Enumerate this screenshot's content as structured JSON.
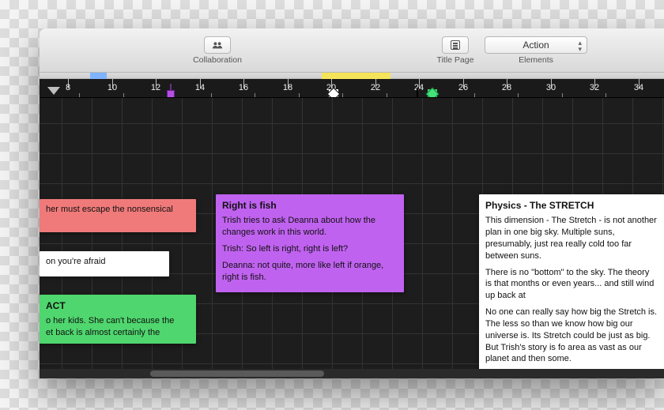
{
  "toolbar": {
    "collaboration_label": "Collaboration",
    "titlepage_label": "Title Page",
    "elements_label": "Elements",
    "elements_selected": "Action"
  },
  "ruler": {
    "ticks": [
      8,
      10,
      12,
      14,
      16,
      18,
      20,
      22,
      24,
      26,
      28,
      30,
      32,
      34
    ],
    "highlights": {
      "blue": {
        "start": 9,
        "end": 9.8
      },
      "yellow": {
        "start": 19.6,
        "end": 22.8
      }
    },
    "markers": {
      "scrubber": 7.3,
      "purple": 12.6,
      "diamond_white": 20.1,
      "square_white": 24.1,
      "diamond_green": 24.6
    }
  },
  "cards": {
    "pink": {
      "text": "her must escape the nonsensical"
    },
    "white_small": {
      "text": "on you're afraid"
    },
    "green": {
      "title": "ACT",
      "text": "o her kids. She can't because the\net back is almost certainly the"
    },
    "purple": {
      "title": "Right is fish",
      "p1": "Trish tries to ask Deanna about how the changes work in this world.",
      "p2": "Trish: So left is right, right is left?",
      "p3": "Deanna: not quite, more like left if orange, right is fish."
    },
    "physics": {
      "title": "Physics - The STRETCH",
      "p1": "This dimension - The Stretch - is not another plan in one big sky. Multiple suns, presumably, just rea really cold too far between suns.",
      "p2": "There is no \"bottom\" to the sky. The theory is that months or even years... and still wind up back at",
      "p3": "No one can really say how big the Stretch is. The less so than we know how big our universe is. Its Stretch could be just as big. But Trish's story is fo area as vast as our planet and then some."
    }
  }
}
